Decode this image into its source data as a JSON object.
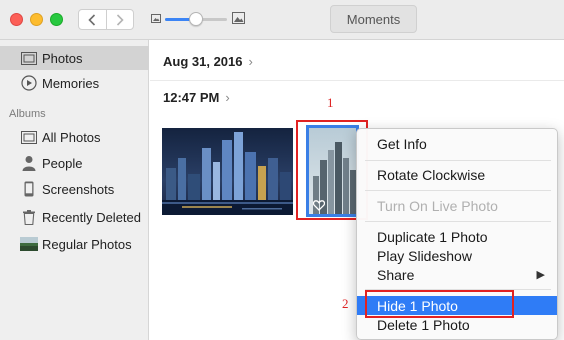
{
  "window": {
    "title": "Moments",
    "traffic_lights": [
      "close",
      "minimize",
      "zoom"
    ],
    "zoom_slider_level": 0.5
  },
  "sidebar": {
    "items_top": [
      {
        "label": "Photos",
        "icon": "photos-icon",
        "selected": true
      },
      {
        "label": "Memories",
        "icon": "memories-icon",
        "selected": false
      }
    ],
    "section_header": "Albums",
    "albums": [
      {
        "label": "All Photos",
        "icon": "all-photos-icon"
      },
      {
        "label": "People",
        "icon": "person-icon"
      },
      {
        "label": "Screenshots",
        "icon": "phone-icon"
      },
      {
        "label": "Recently Deleted",
        "icon": "trash-icon"
      },
      {
        "label": "Regular Photos",
        "icon": "album-thumbnail-icon"
      }
    ]
  },
  "main": {
    "date": "Aug 31, 2016",
    "time": "12:47 PM"
  },
  "annotations": {
    "step1": "1",
    "step2": "2"
  },
  "context_menu": {
    "items": [
      {
        "label": "Get Info",
        "enabled": true
      },
      {
        "label": "Rotate Clockwise",
        "enabled": true
      },
      {
        "label": "Turn On Live Photo",
        "enabled": false
      },
      {
        "label": "Duplicate 1 Photo",
        "enabled": true
      },
      {
        "label": "Play Slideshow",
        "enabled": true
      },
      {
        "label": "Share",
        "enabled": true,
        "submenu": true
      },
      {
        "label": "Hide 1 Photo",
        "enabled": true,
        "highlighted": true
      },
      {
        "label": "Delete 1 Photo",
        "enabled": true
      }
    ]
  },
  "colors": {
    "accent": "#2f7cf6",
    "selection_border": "#3a7fe6",
    "annotation": "#e12222"
  }
}
